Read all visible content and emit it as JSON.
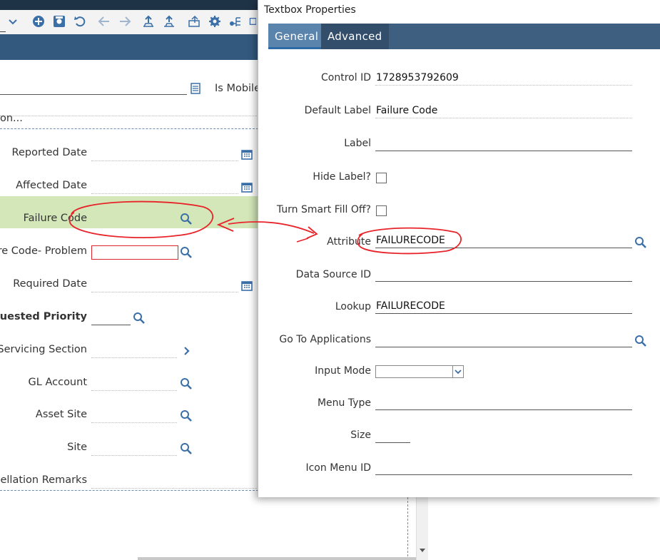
{
  "colors": {
    "header": "#33597e",
    "tab_active": "#5b84ad",
    "highlight": "#d3e7b8",
    "annotation": "#e8232a",
    "icon_blue": "#3b6fa8"
  },
  "toolbar": {
    "icons": [
      "chevron-down-icon",
      "add-icon",
      "save-icon",
      "undo-icon",
      "back-arrow-icon",
      "forward-arrow-icon",
      "upload-icon",
      "route-icon",
      "move-icon",
      "gear-icon",
      "hierarchy-icon"
    ]
  },
  "background_form": {
    "is_mobile_label": "Is Mobile",
    "description_text": "on...",
    "fields": [
      {
        "label": "Reported Date"
      },
      {
        "label": "Affected Date"
      },
      {
        "label": "Failure Code"
      },
      {
        "label": "re Code- Problem"
      },
      {
        "label": "Required Date"
      },
      {
        "label": "quested Priority"
      },
      {
        "label": "Servicing Section"
      },
      {
        "label": "GL Account"
      },
      {
        "label": "Asset Site"
      },
      {
        "label": "Site"
      },
      {
        "label": "ellation Remarks"
      }
    ]
  },
  "dialog": {
    "title": "Textbox Properties",
    "tabs": [
      {
        "label": "General"
      },
      {
        "label": "Advanced"
      }
    ],
    "fields": {
      "control_id": {
        "label": "Control ID",
        "value": "1728953792609"
      },
      "default_label": {
        "label": "Default Label",
        "value": "Failure Code"
      },
      "label": {
        "label": "Label",
        "value": ""
      },
      "hide_label": {
        "label": "Hide Label?"
      },
      "smart_fill": {
        "label": "Turn Smart Fill Off?"
      },
      "attribute": {
        "label": "Attribute",
        "value": "FAILURECODE"
      },
      "data_source_id": {
        "label": "Data Source ID",
        "value": ""
      },
      "lookup": {
        "label": "Lookup",
        "value": "FAILURECODE"
      },
      "go_to_apps": {
        "label": "Go To Applications",
        "value": ""
      },
      "input_mode": {
        "label": "Input Mode",
        "value": ""
      },
      "menu_type": {
        "label": "Menu Type",
        "value": ""
      },
      "size": {
        "label": "Size",
        "value": ""
      },
      "icon_menu_id": {
        "label": "Icon Menu ID",
        "value": ""
      }
    }
  }
}
